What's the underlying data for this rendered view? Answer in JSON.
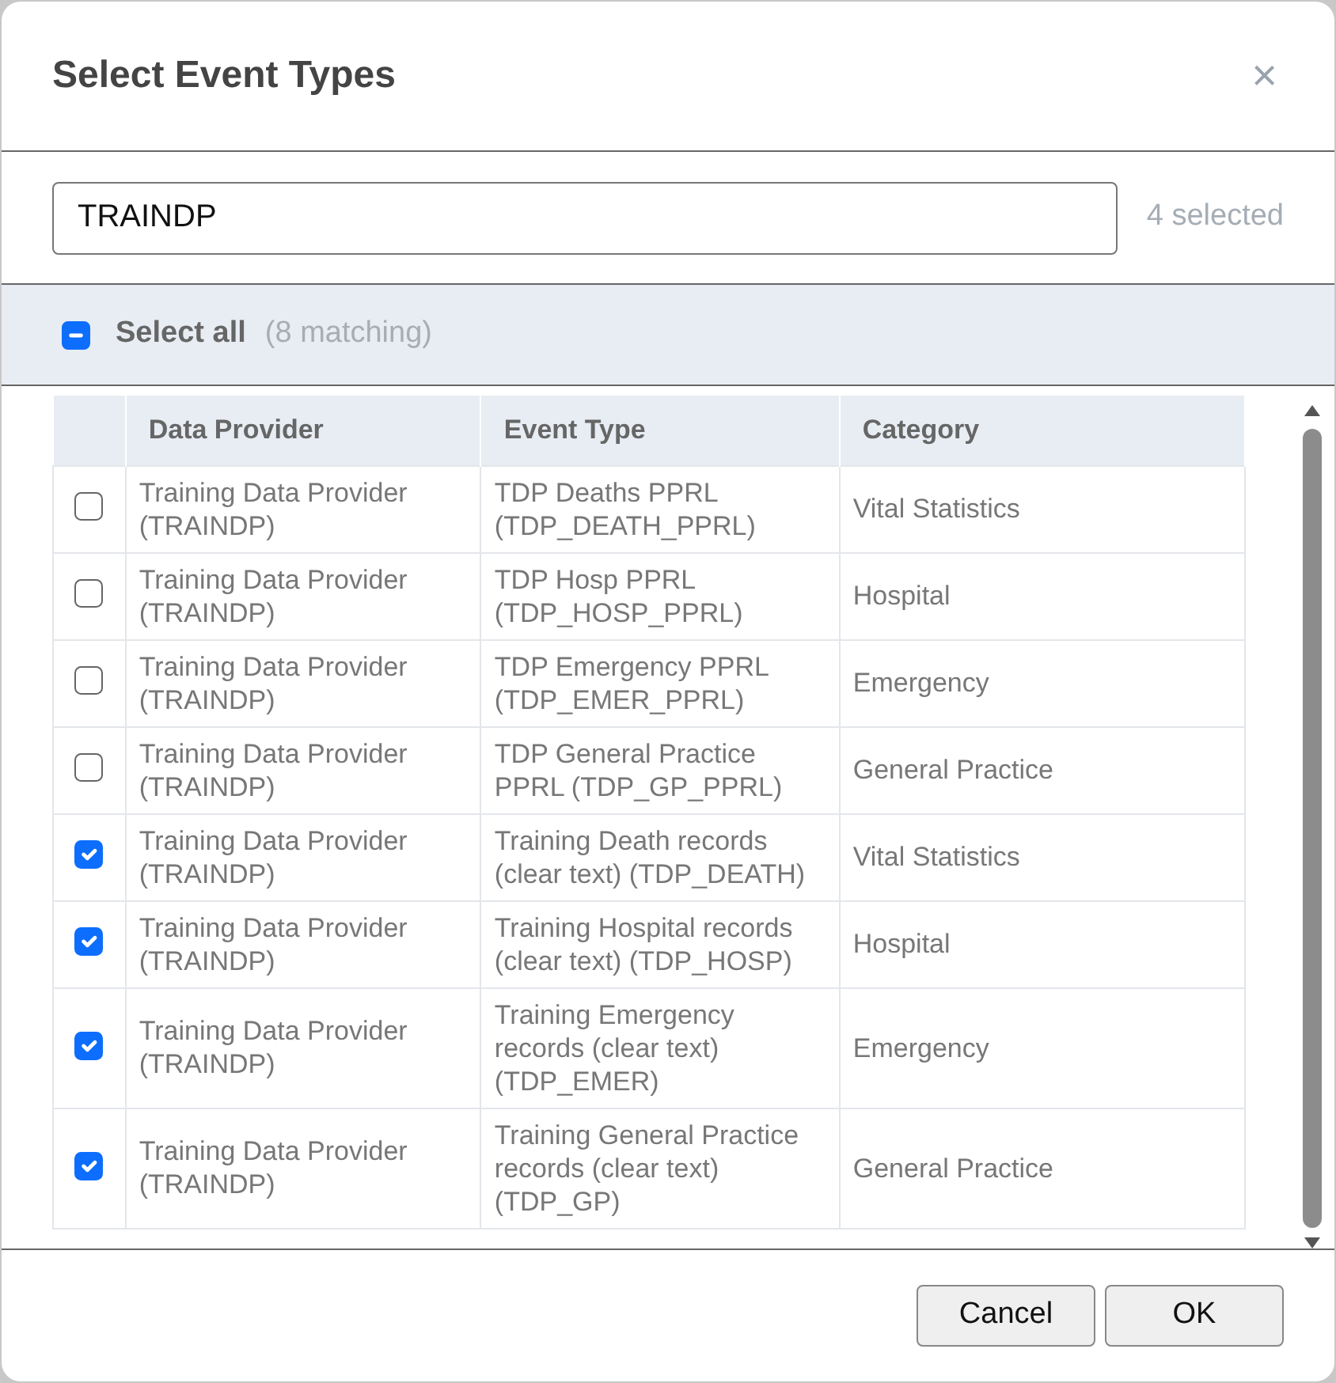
{
  "dialog": {
    "title": "Select Event Types",
    "close": "×"
  },
  "search": {
    "value": "TRAINDP",
    "count": "4 selected"
  },
  "select_all": {
    "label": "Select all",
    "matching": "(8 matching)",
    "partially_checked": true
  },
  "table": {
    "columns": [
      "Data Provider",
      "Event Type",
      "Category"
    ],
    "rows": [
      {
        "checked": false,
        "provider": "Training Data Provider (TRAINDP)",
        "event_type": "TDP Deaths PPRL (TDP_DEATH_PPRL)",
        "category": "Vital Statistics"
      },
      {
        "checked": false,
        "provider": "Training Data Provider (TRAINDP)",
        "event_type": "TDP Hosp PPRL (TDP_HOSP_PPRL)",
        "category": "Hospital"
      },
      {
        "checked": false,
        "provider": "Training Data Provider (TRAINDP)",
        "event_type": "TDP Emergency PPRL (TDP_EMER_PPRL)",
        "category": "Emergency"
      },
      {
        "checked": false,
        "provider": "Training Data Provider (TRAINDP)",
        "event_type": "TDP General Practice PPRL (TDP_GP_PPRL)",
        "category": "General Practice"
      },
      {
        "checked": true,
        "provider": "Training Data Provider (TRAINDP)",
        "event_type": "Training Death records (clear text) (TDP_DEATH)",
        "category": "Vital Statistics"
      },
      {
        "checked": true,
        "provider": "Training Data Provider (TRAINDP)",
        "event_type": "Training Hospital records (clear text) (TDP_HOSP)",
        "category": "Hospital"
      },
      {
        "checked": true,
        "provider": "Training Data Provider (TRAINDP)",
        "event_type": "Training Emergency records (clear text) (TDP_EMER)",
        "category": "Emergency"
      },
      {
        "checked": true,
        "provider": "Training Data Provider (TRAINDP)",
        "event_type": "Training General Practice records (clear text) (TDP_GP)",
        "category": "General Practice"
      }
    ]
  },
  "buttons": [
    "Cancel",
    "OK"
  ]
}
